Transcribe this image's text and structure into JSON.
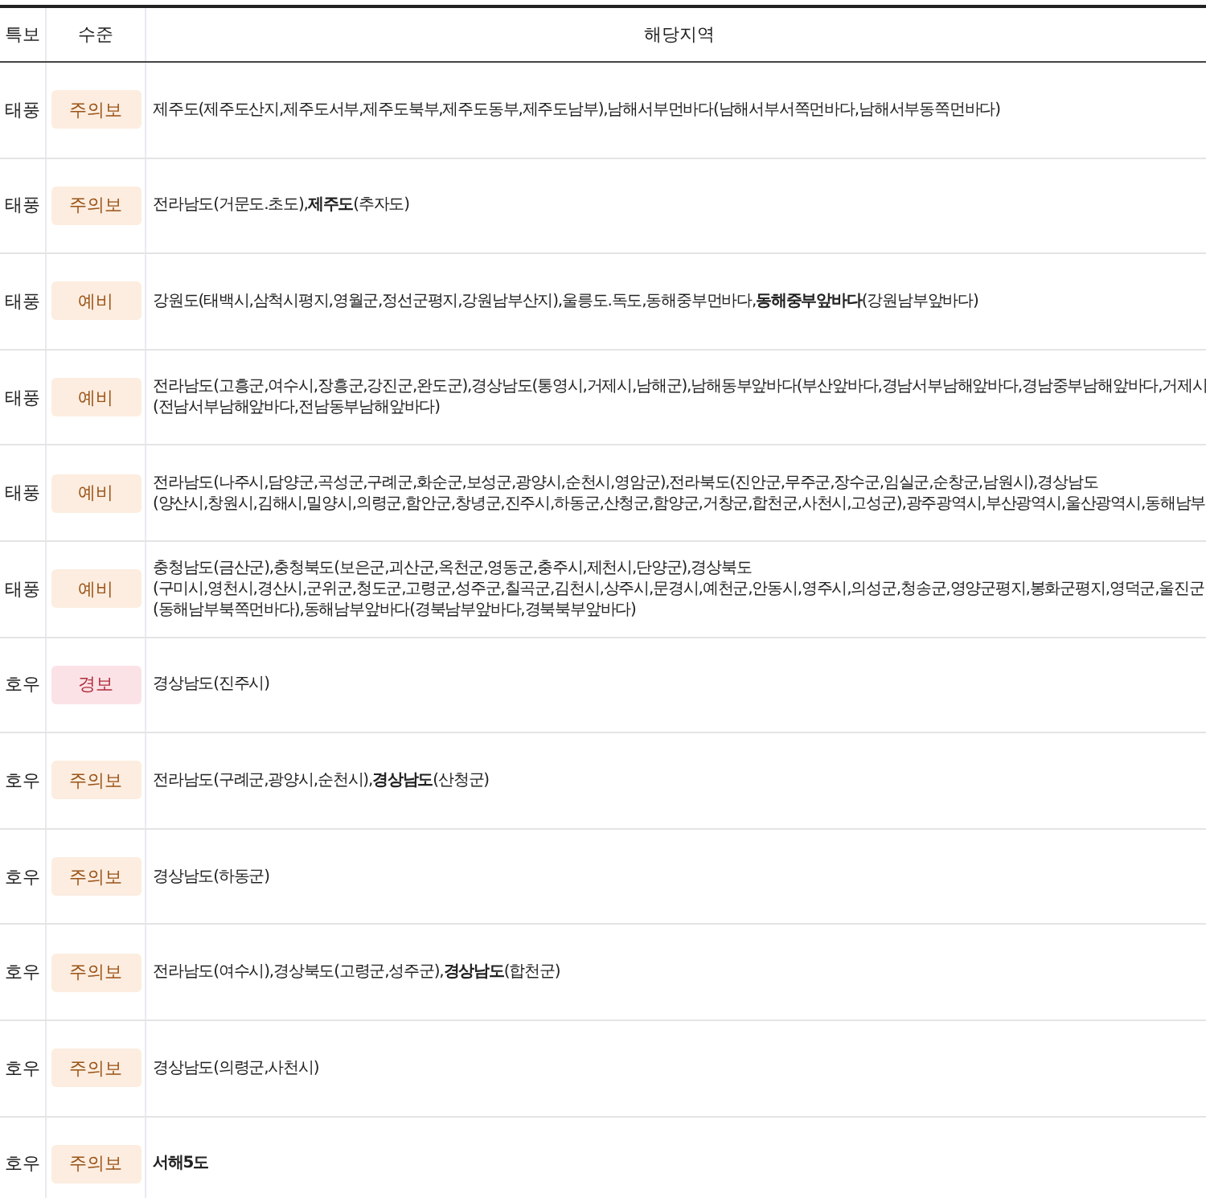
{
  "table": {
    "columns": [
      "특보",
      "수준",
      "해당지역"
    ],
    "rows": [
      {
        "type": "태풍",
        "level": "주의보",
        "kind": "advisory",
        "area": [
          "제주도(제주도산지,제주도서부,제주도북부,제주도동부,제주도남부),남해서부먼바다(남해서부서쪽먼바다,남해서부동쪽먼바다)"
        ]
      },
      {
        "type": "태풍",
        "level": "주의보",
        "kind": "advisory",
        "area": [
          "전라남도(거문도.초도),**제주도**(추자도)"
        ]
      },
      {
        "type": "태풍",
        "level": "예비",
        "kind": "advisory",
        "area": [
          "강원도(태백시,삼척시평지,영월군,정선군평지,강원남부산지),울릉도.독도,동해중부먼바다,**동해중부앞바다**(강원남부앞바다)"
        ]
      },
      {
        "type": "태풍",
        "level": "예비",
        "kind": "advisory",
        "area": [
          "전라남도(고흥군,여수시,장흥군,강진군,완도군),경상남도(통영시,거제시,남해군),남해동부앞바다(부산앞바다,경남서부남해앞바다,경남중부남해앞바다,거제시",
          "(전남서부남해앞바다,전남동부남해앞바다)"
        ]
      },
      {
        "type": "태풍",
        "level": "예비",
        "kind": "advisory",
        "area": [
          "전라남도(나주시,담양군,곡성군,구례군,화순군,보성군,광양시,순천시,영암군),전라북도(진안군,무주군,장수군,임실군,순창군,남원시),경상남도",
          "(양산시,창원시,김해시,밀양시,의령군,함안군,창녕군,진주시,하동군,산청군,함양군,거창군,합천군,사천시,고성군),광주광역시,부산광역시,울산광역시,동해남부"
        ]
      },
      {
        "type": "태풍",
        "level": "예비",
        "kind": "advisory",
        "area": [
          "충청남도(금산군),충청북도(보은군,괴산군,옥천군,영동군,충주시,제천시,단양군),경상북도",
          "(구미시,영천시,경산시,군위군,청도군,고령군,성주군,칠곡군,김천시,상주시,문경시,예천군,안동시,영주시,의성군,청송군,영양군평지,봉화군평지,영덕군,울진군",
          "(동해남부북쪽먼바다),동해남부앞바다(경북남부앞바다,경북북부앞바다)"
        ]
      },
      {
        "type": "호우",
        "level": "경보",
        "kind": "warning",
        "area": [
          "경상남도(진주시)"
        ]
      },
      {
        "type": "호우",
        "level": "주의보",
        "kind": "advisory",
        "area": [
          "전라남도(구례군,광양시,순천시),**경상남도**(산청군)"
        ]
      },
      {
        "type": "호우",
        "level": "주의보",
        "kind": "advisory",
        "area": [
          "경상남도(하동군)"
        ]
      },
      {
        "type": "호우",
        "level": "주의보",
        "kind": "advisory",
        "area": [
          "전라남도(여수시),경상북도(고령군,성주군),**경상남도**(합천군)"
        ]
      },
      {
        "type": "호우",
        "level": "주의보",
        "kind": "advisory",
        "area": [
          "경상남도(의령군,사천시)"
        ]
      },
      {
        "type": "호우",
        "level": "주의보",
        "kind": "advisory",
        "area": [
          "**서해5도**"
        ]
      }
    ]
  }
}
